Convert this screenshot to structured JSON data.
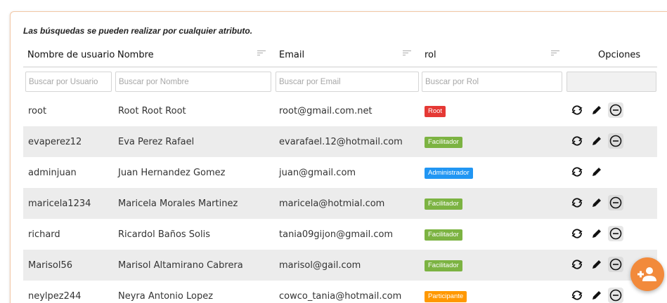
{
  "hint": "Las búsquedas se pueden realizar por cualquier atributo.",
  "columns": {
    "usuario": "Nombre de usuario",
    "nombre": "Nombre",
    "email": "Email",
    "rol": "rol",
    "opciones": "Opciones"
  },
  "filters": {
    "usuario": "Buscar por Usuario",
    "nombre": "Buscar por Nombre",
    "email": "Buscar por Email",
    "rol": "Buscar por Rol"
  },
  "rows": [
    {
      "usuario": "root",
      "nombre": "Root Root Root",
      "email": "root@gmail.com.net",
      "rol": "Root",
      "rol_color": "#e53935",
      "can_delete": true
    },
    {
      "usuario": "evaperez12",
      "nombre": "Eva Perez Rafael",
      "email": "evarafael.12@hotmail.com",
      "rol": "Facilitador",
      "rol_color": "#7cb342",
      "can_delete": true
    },
    {
      "usuario": "adminjuan",
      "nombre": "Juan Hernandez Gomez",
      "email": "juan@gmail.com",
      "rol": "Administrador",
      "rol_color": "#2196f3",
      "can_delete": false
    },
    {
      "usuario": "maricela1234",
      "nombre": "Maricela Morales Martinez",
      "email": "maricela@hotmial.com",
      "rol": "Facilitador",
      "rol_color": "#7cb342",
      "can_delete": true
    },
    {
      "usuario": "richard",
      "nombre": "Ricardol Baños Solis",
      "email": "tania09gijon@gmail.com",
      "rol": "Facilitador",
      "rol_color": "#7cb342",
      "can_delete": true
    },
    {
      "usuario": "Marisol56",
      "nombre": "Marisol Altamirano Cabrera",
      "email": "marisol@gail.com",
      "rol": "Facilitador",
      "rol_color": "#7cb342",
      "can_delete": true
    },
    {
      "usuario": "neylpez244",
      "nombre": "Neyra Antonio Lopez",
      "email": "cowco_tania@hotmail.com",
      "rol": "Participante",
      "rol_color": "#ff9800",
      "can_delete": true
    }
  ],
  "icons": {
    "refresh": "refresh-icon",
    "edit": "pencil-icon",
    "delete": "minus-circle-icon",
    "sort": "sort-icon",
    "fab": "add-user-icon"
  },
  "colors": {
    "fab": "#f28a3b",
    "card_border": "#f2c7a5"
  }
}
